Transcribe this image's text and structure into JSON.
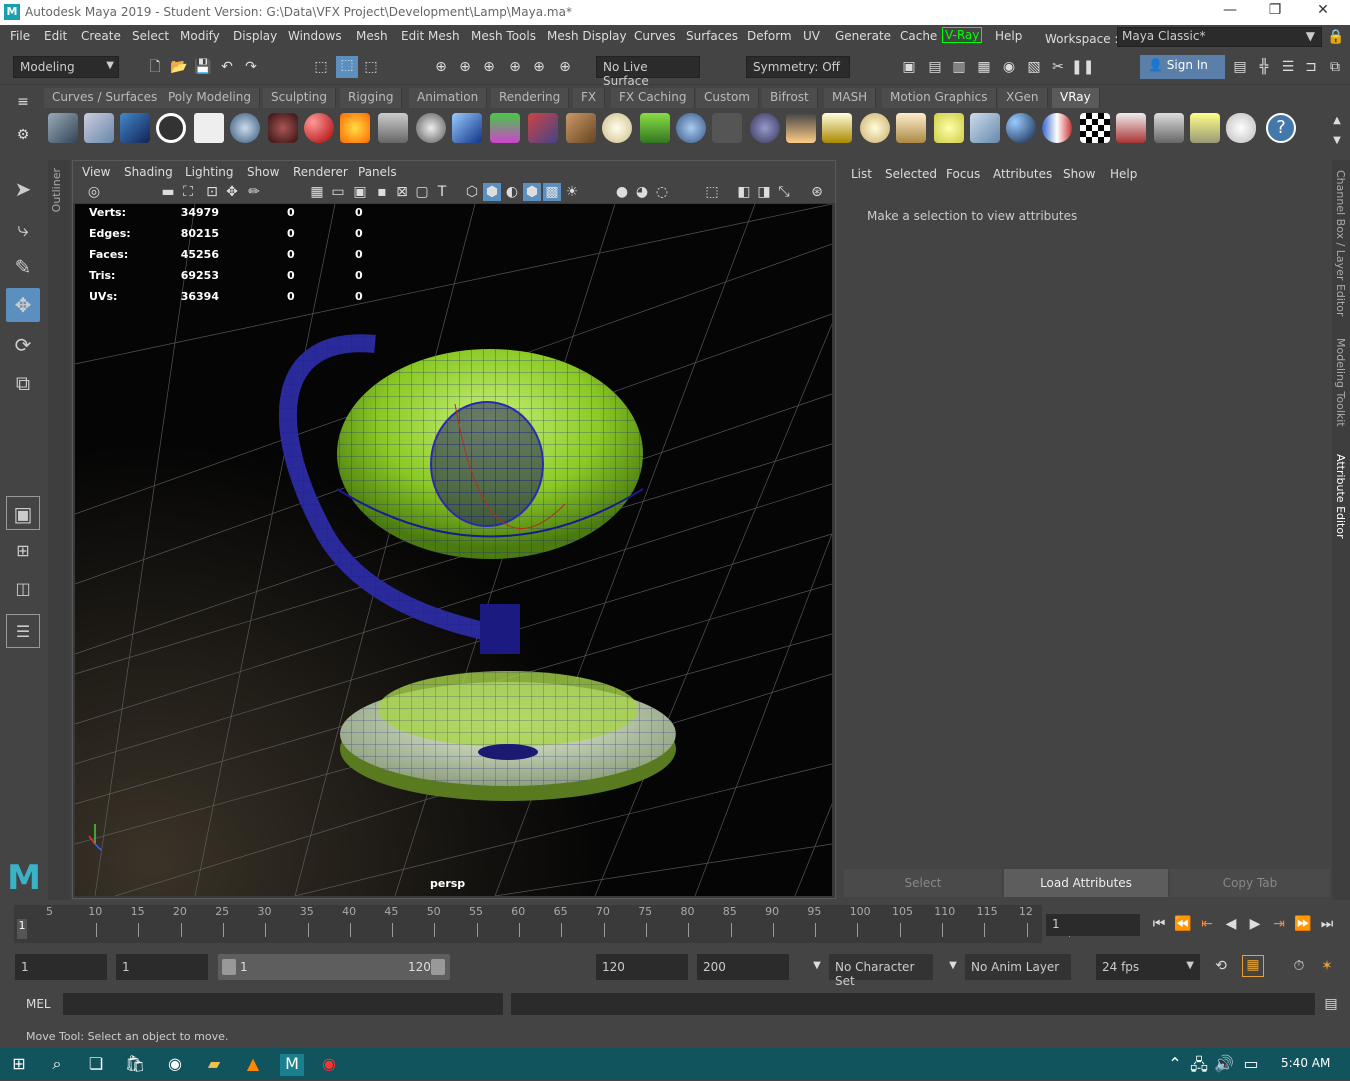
{
  "window": {
    "title": "Autodesk Maya 2019 - Student Version: G:\\Data\\VFX Project\\Development\\Lamp\\Maya.ma*",
    "minimize": "—",
    "restore": "❐",
    "close": "✕"
  },
  "menubar": {
    "items": [
      "File",
      "Edit",
      "Create",
      "Select",
      "Modify",
      "Display",
      "Windows",
      "Mesh",
      "Edit Mesh",
      "Mesh Tools",
      "Mesh Display",
      "Curves",
      "Surfaces",
      "Deform",
      "UV",
      "Generate",
      "Cache",
      "V-Ray",
      "Help"
    ],
    "workspace_label": "Workspace :",
    "workspace_value": "Maya Classic*"
  },
  "toolbar": {
    "mode": "Modeling",
    "live_surface": "No Live Surface",
    "symmetry": "Symmetry: Off",
    "sign_in": "Sign In"
  },
  "shelf_tabs": [
    "Curves / Surfaces",
    "Poly Modeling",
    "Sculpting",
    "Rigging",
    "Animation",
    "Rendering",
    "FX",
    "FX Caching",
    "Custom",
    "Bifrost",
    "MASH",
    "Motion Graphics",
    "XGen",
    "VRay"
  ],
  "active_shelf": "VRay",
  "viewport": {
    "menu": [
      "View",
      "Shading",
      "Lighting",
      "Show",
      "Renderer",
      "Panels"
    ],
    "camera": "persp",
    "outliner_label": "Outliner",
    "hud": [
      {
        "label": "Verts:",
        "v1": "34979",
        "v2": "0",
        "v3": "0"
      },
      {
        "label": "Edges:",
        "v1": "80215",
        "v2": "0",
        "v3": "0"
      },
      {
        "label": "Faces:",
        "v1": "45256",
        "v2": "0",
        "v3": "0"
      },
      {
        "label": "Tris:",
        "v1": "69253",
        "v2": "0",
        "v3": "0"
      },
      {
        "label": "UVs:",
        "v1": "36394",
        "v2": "0",
        "v3": "0"
      }
    ]
  },
  "attribute_editor": {
    "menu": [
      "List",
      "Selected",
      "Focus",
      "Attributes",
      "Show",
      "Help"
    ],
    "message": "Make a selection to view attributes",
    "buttons": {
      "select": "Select",
      "load": "Load Attributes",
      "copy": "Copy Tab"
    }
  },
  "side_tabs": [
    "Channel Box / Layer Editor",
    "Modeling Toolkit",
    "Attribute Editor"
  ],
  "timeline": {
    "ticks": [
      "5",
      "10",
      "15",
      "20",
      "25",
      "30",
      "35",
      "40",
      "45",
      "50",
      "55",
      "60",
      "65",
      "70",
      "75",
      "80",
      "85",
      "90",
      "95",
      "100",
      "105",
      "110",
      "115",
      "12"
    ],
    "current_frame": "1",
    "start_marker": "1"
  },
  "range": {
    "start": "1",
    "anim_start": "1",
    "slider_start": "1",
    "slider_end": "120",
    "end": "120",
    "anim_end": "200",
    "character_set": "No Character Set",
    "anim_layer": "No Anim Layer",
    "fps": "24 fps"
  },
  "command_line": {
    "label": "MEL"
  },
  "help_line": "Move Tool: Select an object to move.",
  "taskbar": {
    "time": "5:40 AM"
  },
  "colors": {
    "accent": "#5a9bd4",
    "vray_green": "#00ff00",
    "lamp_green": "#8fd12a",
    "wire_blue": "#1a1ab0"
  }
}
